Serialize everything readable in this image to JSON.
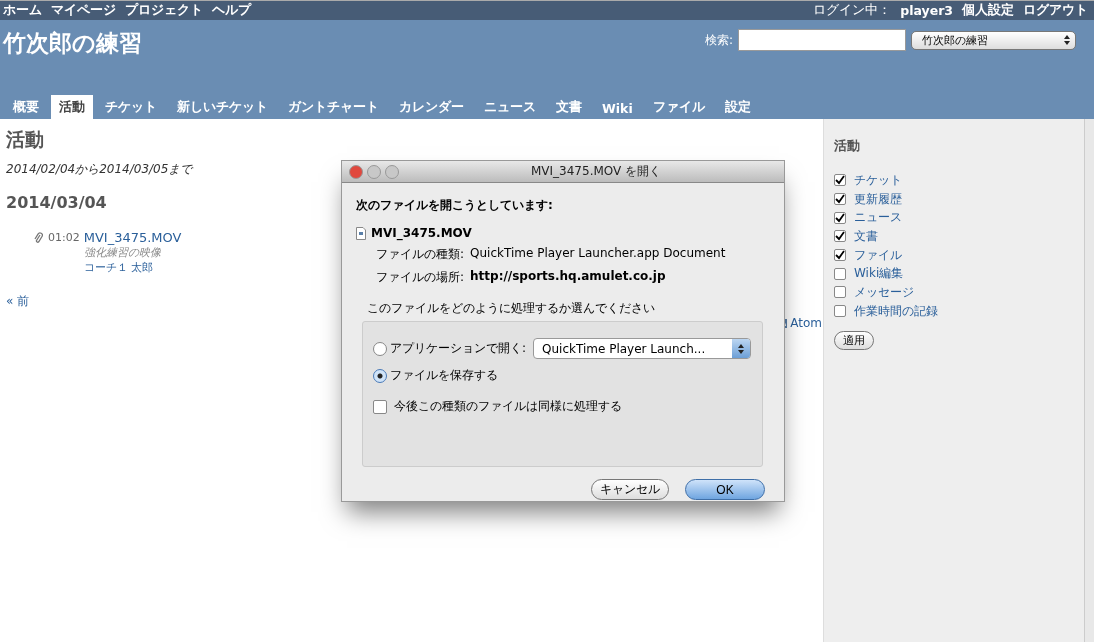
{
  "top_menu": [
    "ホーム",
    "マイページ",
    "プロジェクト",
    "ヘルプ"
  ],
  "login": {
    "label": "ログイン中：",
    "user": "player3"
  },
  "account_links": [
    "個人設定",
    "ログアウト"
  ],
  "header": {
    "title": "竹次郎の練習",
    "search_label": "検索:",
    "project_select": "竹次郎の練習"
  },
  "tabs": [
    {
      "label": "概要",
      "selected": false
    },
    {
      "label": "活動",
      "selected": true
    },
    {
      "label": "チケット",
      "selected": false
    },
    {
      "label": "新しいチケット",
      "selected": false
    },
    {
      "label": "ガントチャート",
      "selected": false
    },
    {
      "label": "カレンダー",
      "selected": false
    },
    {
      "label": "ニュース",
      "selected": false
    },
    {
      "label": "文書",
      "selected": false
    },
    {
      "label": "Wiki",
      "selected": false
    },
    {
      "label": "ファイル",
      "selected": false
    },
    {
      "label": "設定",
      "selected": false
    }
  ],
  "content": {
    "title": "活動",
    "range": "2014/02/04から2014/03/05まで",
    "date_heading": "2014/03/04",
    "events": [
      {
        "time": "01:02",
        "title": "MVI_3475.MOV",
        "description": "強化練習の映像",
        "author": "コーチ１ 太郎"
      }
    ],
    "prev_link": "« 前",
    "atom_link": "Atom"
  },
  "sidebar": {
    "title": "活動",
    "filters": [
      {
        "label": "チケット",
        "checked": true
      },
      {
        "label": "更新履歴",
        "checked": true
      },
      {
        "label": "ニュース",
        "checked": true
      },
      {
        "label": "文書",
        "checked": true
      },
      {
        "label": "ファイル",
        "checked": true
      },
      {
        "label": "Wiki編集",
        "checked": false
      },
      {
        "label": "メッセージ",
        "checked": false
      },
      {
        "label": "作業時間の記録",
        "checked": false
      }
    ],
    "apply_button": "適用"
  },
  "dialog": {
    "title": "MVI_3475.MOV を開く",
    "intro": "次のファイルを開こうとしています:",
    "file_name": "MVI_3475.MOV",
    "type_label": "ファイルの種類:",
    "type_value": "QuickTime Player Launcher.app Document",
    "location_label": "ファイルの場所:",
    "location_value": "http://sports.hq.amulet.co.jp",
    "question": "このファイルをどのように処理するか選んでください",
    "options": [
      {
        "kind": "app",
        "label": "アプリケーションで開く:",
        "selected": false,
        "app": "QuickTime Player Launch..."
      },
      {
        "kind": "save",
        "label": "ファイルを保存する",
        "selected": true
      }
    ],
    "remember": {
      "label": "今後この種類のファイルは同様に処理する",
      "checked": false
    },
    "buttons": [
      {
        "kind": "cancel",
        "label": "キャンセル"
      },
      {
        "kind": "default",
        "label": "OK"
      }
    ]
  }
}
